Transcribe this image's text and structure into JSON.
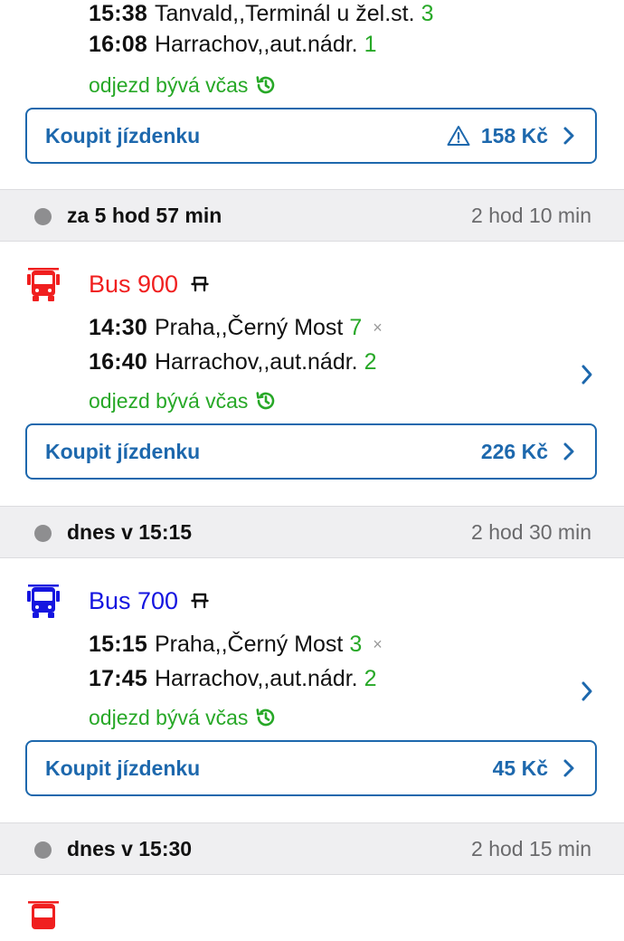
{
  "top_connection": {
    "stops": [
      {
        "time": "15:38",
        "place": "Tanvald,,Terminál u žel.st.",
        "platform": "3"
      },
      {
        "time": "16:08",
        "place": "Harrachov,,aut.nádr.",
        "platform": "1"
      }
    ],
    "status": "odjezd bývá včas",
    "buy": {
      "label": "Koupit jízdenku",
      "price": "158 Kč",
      "warning": true
    }
  },
  "connections": [
    {
      "header": {
        "when": "za 5 hod 57 min",
        "duration": "2 hod 10 min"
      },
      "line": {
        "name": "Bus 900",
        "color": "#f01f1f"
      },
      "stops": [
        {
          "time": "14:30",
          "place": "Praha,,Černý Most",
          "platform": "7",
          "mark": "×"
        },
        {
          "time": "16:40",
          "place": "Harrachov,,aut.nádr.",
          "platform": "2"
        }
      ],
      "status": "odjezd bývá včas",
      "buy": {
        "label": "Koupit jízdenku",
        "price": "226 Kč"
      }
    },
    {
      "header": {
        "when": "dnes v 15:15",
        "duration": "2 hod 30 min"
      },
      "line": {
        "name": "Bus 700",
        "color": "#1515e0"
      },
      "stops": [
        {
          "time": "15:15",
          "place": "Praha,,Černý Most",
          "platform": "3",
          "mark": "×"
        },
        {
          "time": "17:45",
          "place": "Harrachov,,aut.nádr.",
          "platform": "2"
        }
      ],
      "status": "odjezd bývá včas",
      "buy": {
        "label": "Koupit jízdenku",
        "price": "45 Kč"
      }
    },
    {
      "header": {
        "when": "dnes v 15:30",
        "duration": "2 hod 15 min"
      },
      "line": {
        "name": "",
        "color": "#f01f1f"
      }
    }
  ],
  "colors": {
    "accent": "#1d68ad",
    "ontime": "#27a827",
    "platform": "#27a827"
  }
}
